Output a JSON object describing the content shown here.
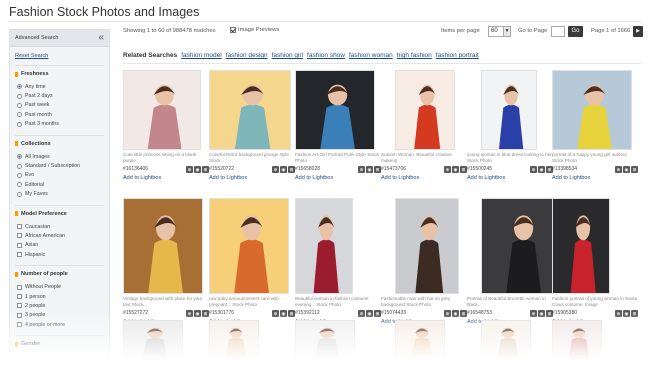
{
  "page": {
    "title": "Fashion Stock Photos and Images"
  },
  "sidebar": {
    "header": "Advanced Search",
    "reset": "Reset Search",
    "sections": [
      {
        "title": "Freshness",
        "type": "radio",
        "options": [
          "Any time",
          "Past 2 days",
          "Past week",
          "Past month",
          "Past 3 months"
        ],
        "selected": 0
      },
      {
        "title": "Collections",
        "type": "radio",
        "options": [
          "All Images",
          "Standard / Subscription",
          "Evo",
          "Editorial",
          "My Faves"
        ],
        "selected": 0
      },
      {
        "title": "Model Preference",
        "type": "checkbox",
        "options": [
          "Caucasian",
          "African American",
          "Asian",
          "Hispanic"
        ]
      },
      {
        "title": "Number of people",
        "type": "checkbox",
        "options": [
          "Without People",
          "1 person",
          "2 people",
          "3 people",
          "4 people or more"
        ]
      },
      {
        "title": "Gender",
        "type": "checkbox",
        "options": []
      }
    ]
  },
  "topbar": {
    "showing": "Showing 1 to 60 of 988478 matches",
    "image_previews": "Image Previews",
    "items_per_page_label": "Items per page",
    "items_per_page_value": "60",
    "goto_label": "Go to Page",
    "go_button": "Go",
    "page_of": "Page 1 of 1666",
    "next_icon": "next-arrow-icon"
  },
  "related": {
    "label": "Related Searches",
    "links": [
      "fashion model",
      "fashion design",
      "fashion girl",
      "fashion show",
      "fashion woman",
      "high fashion",
      "fashion portrait"
    ]
  },
  "images": [
    {
      "id": "#16136406",
      "caption": "Cute little princess sitting on a blank purple...",
      "lightbox": "Add to Lightbox",
      "bg": "#f2e8e6",
      "fg": "#c4868d"
    },
    {
      "id": "#15520722",
      "caption": "Colorful Retro background grunge style Stock...",
      "lightbox": "Add to Lightbox",
      "bg": "#f4d78c",
      "fg": "#7fb6ba"
    },
    {
      "id": "#15658028",
      "caption": "Fashion Art Girl Portrait Punk Style Stock Photo",
      "lightbox": "Add to Lightbox",
      "bg": "#23262b",
      "fg": "#3a7fb8"
    },
    {
      "id": "#15473706",
      "caption": "Autumn Woman. Beautiful creative makeup",
      "lightbox": "Add to Lightbox",
      "bg": "#f7ece4",
      "fg": "#d43a1f"
    },
    {
      "id": "#15500245",
      "caption": "young woman in blue dress looking to her. Stock Photo",
      "lightbox": "Add to Lightbox",
      "bg": "#f2f3f5",
      "fg": "#2a3fa8"
    },
    {
      "id": "#13398534",
      "caption": "portrait of a happy young girl outdoor Stock Photo",
      "lightbox": "Add to Lightbox",
      "bg": "#b6c9d8",
      "fg": "#e6d23a"
    },
    {
      "id": "#15527272",
      "caption": "Vintage background with place for your text Stock...",
      "lightbox": "Add to Lightbox",
      "bg": "#a86f34",
      "fg": "#e6b84a"
    },
    {
      "id": "#15301776",
      "caption": "raw baby announcement card with pregnant... Stock Photo",
      "lightbox": "Add to Lightbox",
      "bg": "#f7cf78",
      "fg": "#d86a2e"
    },
    {
      "id": "#15392112",
      "caption": "Beautiful woman in fashion costume evening... Stock Photo",
      "lightbox": "Add to Lightbox",
      "bg": "#d6d7da",
      "fg": "#9a1c2e"
    },
    {
      "id": "#15074433",
      "caption": "Fashionable man with hat on grey background Stock Photo",
      "lightbox": "Add to Lightbox",
      "bg": "#c9cbce",
      "fg": "#3b2b22"
    },
    {
      "id": "#16548753",
      "caption": "Portrait of Beautiful Brunette woman in black...",
      "lightbox": "Add to Lightbox",
      "bg": "#3b3b3e",
      "fg": "#1c1c1e"
    },
    {
      "id": "#15905380",
      "caption": "Fashion portrait of young woman in Santa Claus costume. Image",
      "lightbox": "Add to Lightbox",
      "bg": "#2a2a2c",
      "fg": "#c8232c"
    },
    {
      "id": "",
      "caption": "",
      "lightbox": "",
      "bg": "#e9e9ea",
      "fg": "#bdbdbd"
    },
    {
      "id": "",
      "caption": "",
      "lightbox": "",
      "bg": "#f4ede6",
      "fg": "#e0c09a"
    },
    {
      "id": "",
      "caption": "",
      "lightbox": "",
      "bg": "#f0f0f0",
      "fg": "#d0d0d0"
    },
    {
      "id": "",
      "caption": "",
      "lightbox": "",
      "bg": "#f4ece2",
      "fg": "#e8c59a"
    },
    {
      "id": "",
      "caption": "",
      "lightbox": "",
      "bg": "#f5f0ea",
      "fg": "#d8c0a8"
    },
    {
      "id": "",
      "caption": "",
      "lightbox": "",
      "bg": "#f2e6e6",
      "fg": "#d88a8a"
    }
  ]
}
